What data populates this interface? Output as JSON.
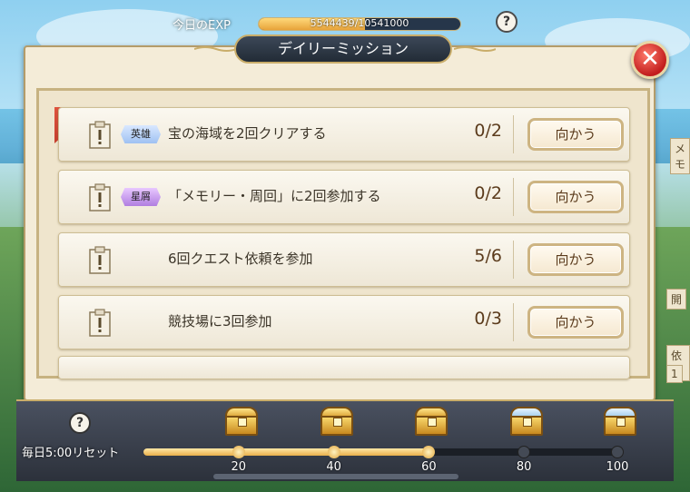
{
  "exp": {
    "label": "今日のEXP",
    "current": 5544439,
    "max": 10541000,
    "text": "5544439/10541000"
  },
  "help_top": "?",
  "title": "デイリーミッション",
  "close_glyph": "✕",
  "side_tabs": [
    "メモ",
    "開",
    "依頼",
    "1"
  ],
  "missions": [
    {
      "badge": "英雄",
      "badge_color": "blue",
      "text": "宝の海域を2回クリアする",
      "progress": "0/2",
      "button": "向かう"
    },
    {
      "badge": "星屑",
      "badge_color": "purple",
      "text": "「メモリー・周回」に2回参加する",
      "progress": "0/2",
      "button": "向かう"
    },
    {
      "badge": "",
      "badge_color": "",
      "text": "6回クエスト依頼を参加",
      "progress": "5/6",
      "button": "向かう"
    },
    {
      "badge": "",
      "badge_color": "",
      "text": "競技場に3回参加",
      "progress": "0/3",
      "button": "向かう"
    }
  ],
  "rewards": {
    "help": "?",
    "reset_label": "毎日5:00リセット",
    "progress_value": 60,
    "max_value": 100,
    "milestones": [
      {
        "label": "20",
        "chest": "gold-chest-icon",
        "reached": true
      },
      {
        "label": "40",
        "chest": "gold-chest-icon",
        "reached": true
      },
      {
        "label": "60",
        "chest": "gold-chest-icon",
        "reached": true
      },
      {
        "label": "80",
        "chest": "blue-chest-icon",
        "reached": false
      },
      {
        "label": "100",
        "chest": "blue-chest-icon",
        "reached": false
      }
    ]
  },
  "colors": {
    "accent": "#c9ad6a",
    "close": "#c21d1d",
    "panel": "#f4ecd8"
  }
}
